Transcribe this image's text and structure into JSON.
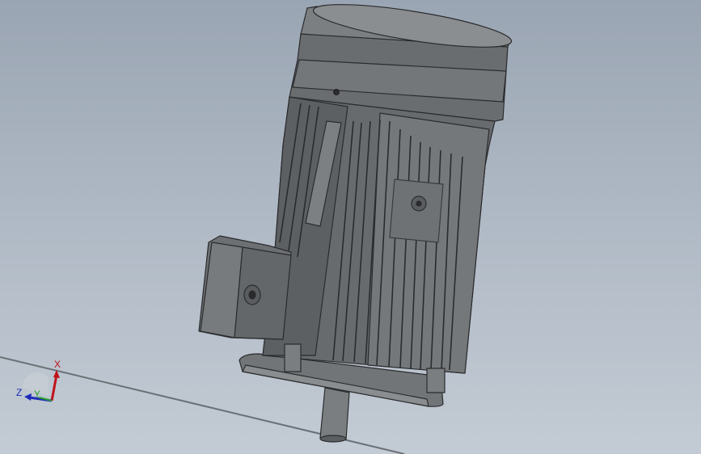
{
  "viewport": {
    "background_top": "#9aa5b3",
    "background_bottom": "#c3cbd4",
    "model_color": "#6f7275",
    "model_edge_color": "#2a2b2d"
  },
  "triad": {
    "x_label": "X",
    "y_label": "Y",
    "z_label": "Z",
    "x_color": "#c0121a",
    "y_color": "#2aa02a",
    "z_color": "#1d2bb8"
  }
}
